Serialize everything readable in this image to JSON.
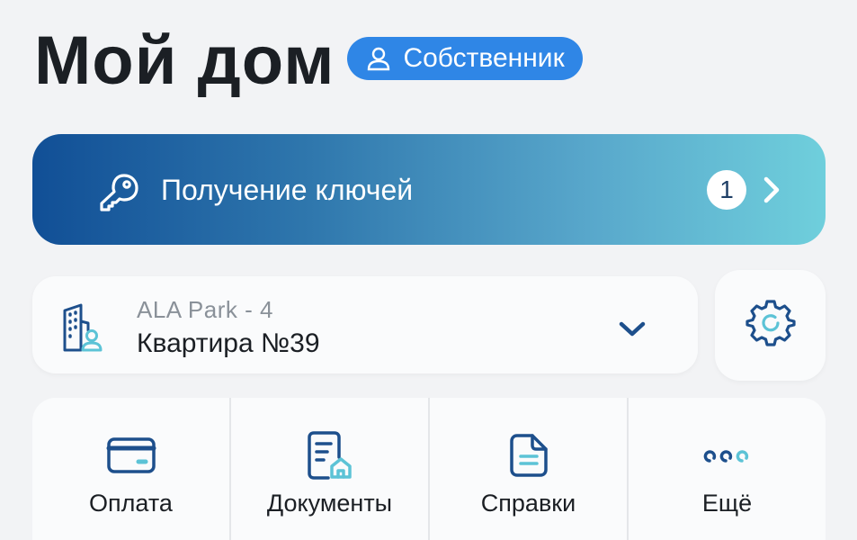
{
  "header": {
    "title": "Мой дом",
    "role_badge": "Собственник",
    "role_icon": "user-icon"
  },
  "keys_banner": {
    "label": "Получение ключей",
    "count": "1",
    "icon": "key-icon",
    "gradient": [
      "#114f96",
      "#6fcfdc"
    ]
  },
  "apartment_selector": {
    "complex": "ALA Park - 4",
    "apartment": "Квартира №39",
    "icon": "building-user-icon"
  },
  "settings": {
    "icon": "gear-icon"
  },
  "quick_actions": [
    {
      "label": "Оплата",
      "icon": "card-icon"
    },
    {
      "label": "Документы",
      "icon": "document-home-icon"
    },
    {
      "label": "Справки",
      "icon": "certificate-icon"
    },
    {
      "label": "Ещё",
      "icon": "more-icon"
    }
  ],
  "colors": {
    "accent": "#2f86e6",
    "icon_dark": "#1d4f8c",
    "icon_light": "#5cc3d6",
    "background": "#f2f3f5"
  }
}
